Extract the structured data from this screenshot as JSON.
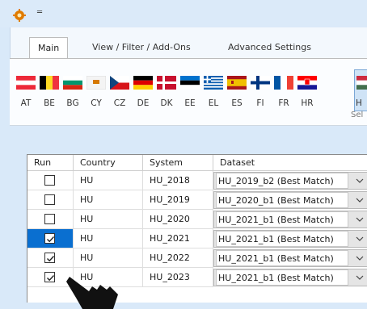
{
  "window": {
    "quick_access_symbol": "═"
  },
  "tabs": [
    {
      "label": "Main",
      "active": true
    },
    {
      "label": "View / Filter / Add-Ons",
      "active": false
    },
    {
      "label": "Advanced Settings",
      "active": false
    }
  ],
  "countries": [
    "AT",
    "BE",
    "BG",
    "CY",
    "CZ",
    "DE",
    "DK",
    "EE",
    "EL",
    "ES",
    "FI",
    "FR",
    "HR",
    "H"
  ],
  "select_label": "Sel",
  "table": {
    "headers": [
      "Run",
      "Country",
      "System",
      "Dataset"
    ],
    "rows": [
      {
        "run": false,
        "country": "HU",
        "system": "HU_2018",
        "dataset": "HU_2019_b2 (Best Match)"
      },
      {
        "run": false,
        "country": "HU",
        "system": "HU_2019",
        "dataset": "HU_2020_b1 (Best Match)"
      },
      {
        "run": false,
        "country": "HU",
        "system": "HU_2020",
        "dataset": "HU_2021_b1 (Best Match)"
      },
      {
        "run": true,
        "country": "HU",
        "system": "HU_2021",
        "dataset": "HU_2021_b1 (Best Match)"
      },
      {
        "run": true,
        "country": "HU",
        "system": "HU_2022",
        "dataset": "HU_2021_b1 (Best Match)"
      },
      {
        "run": true,
        "country": "HU",
        "system": "HU_2023",
        "dataset": "HU_2021_b1 (Best Match)"
      }
    ]
  },
  "colors": {
    "selection": "#0a6fd0",
    "background": "#d9e9f9"
  },
  "icons": {
    "app": "gear-icon",
    "cursor": "hand-pointer-icon",
    "dropdown": "chevron-down-icon"
  }
}
